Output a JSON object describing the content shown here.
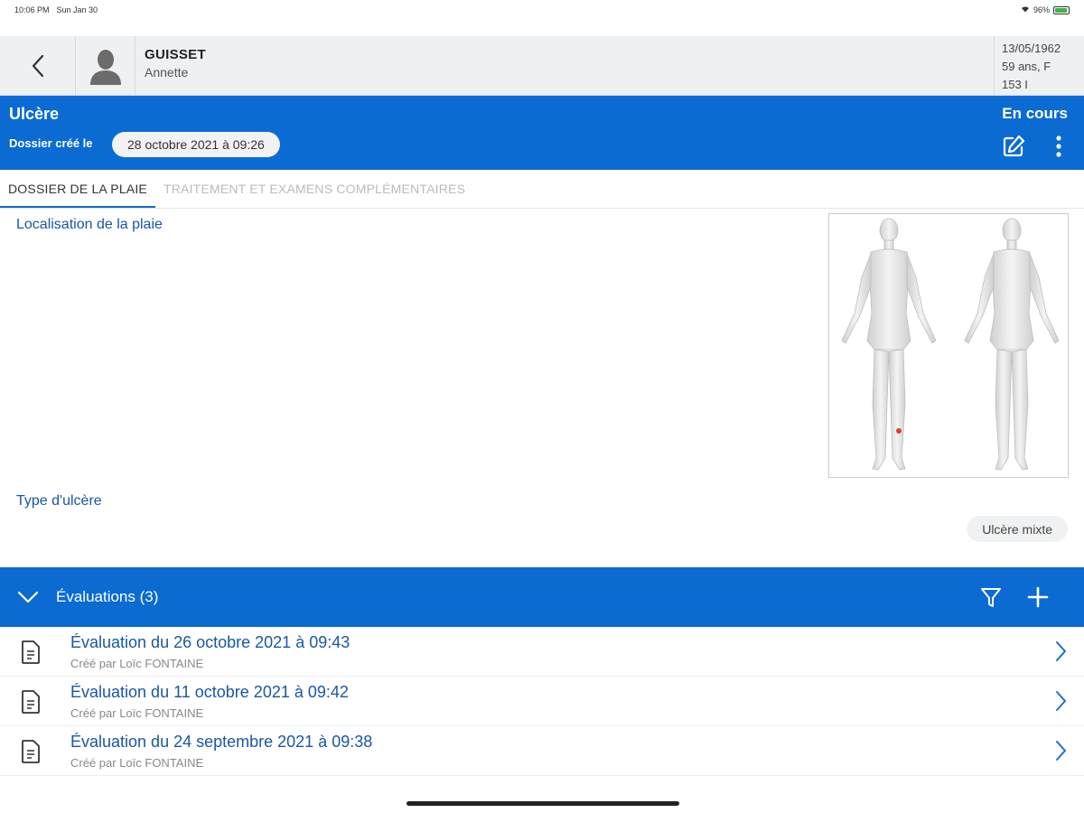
{
  "status_bar": {
    "time": "10:06 PM",
    "date": "Sun Jan 30",
    "battery": "96%",
    "battery_level": 0.96
  },
  "patient": {
    "last_name": "GUISSET",
    "first_name": "Annette",
    "birth_date": "13/05/1962",
    "age_sex": "59 ans, F",
    "id": "153 I"
  },
  "wound": {
    "title": "Ulcère",
    "created_label": "Dossier créé le",
    "created_date": "28 octobre 2021 à 09:26",
    "status": "En cours"
  },
  "tabs": [
    {
      "label": "DOSSIER DE LA PLAIE",
      "active": true
    },
    {
      "label": "TRAITEMENT ET EXAMENS COMPLÉMENTAIRES",
      "active": false
    }
  ],
  "location": {
    "label": "Localisation de la plaie"
  },
  "ulcer_type": {
    "label": "Type d'ulcère",
    "value": "Ulcère mixte"
  },
  "evaluations": {
    "label": "Évaluations (3)",
    "items": [
      {
        "title": "Évaluation du 26 octobre 2021 à 09:43",
        "author": "Créé par Loïc FONTAINE"
      },
      {
        "title": "Évaluation du 11 octobre 2021 à 09:42",
        "author": "Créé par Loïc FONTAINE"
      },
      {
        "title": "Évaluation du 24 septembre 2021 à 09:38",
        "author": "Créé par Loïc FONTAINE"
      }
    ]
  },
  "colors": {
    "primary": "#0b6bd3",
    "link": "#1a56a8",
    "wound_marker": "#e53935"
  }
}
